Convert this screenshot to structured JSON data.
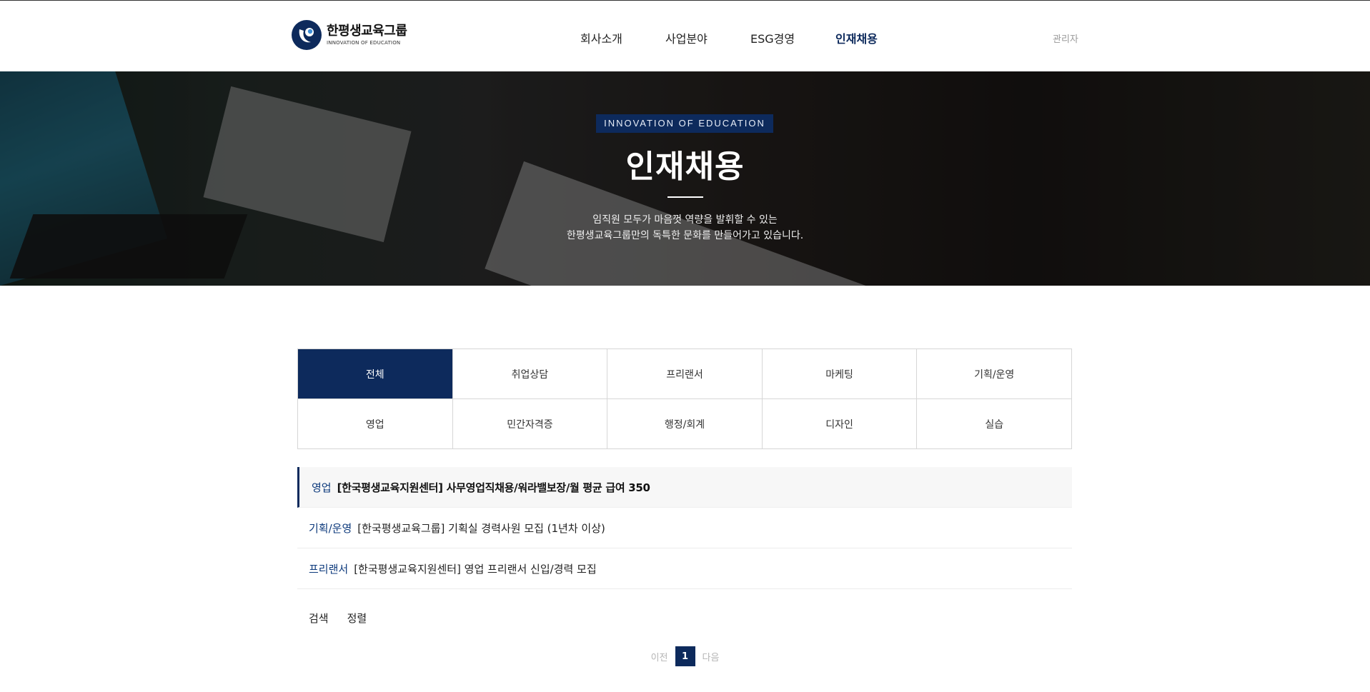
{
  "header": {
    "logo": {
      "title": "한평생교육그룹",
      "subtitle": "INNOVATION OF EDUCATION",
      "brand_color": "#0d2a5c"
    },
    "nav": [
      {
        "label": "회사소개",
        "active": false
      },
      {
        "label": "사업분야",
        "active": false
      },
      {
        "label": "ESG경영",
        "active": false
      },
      {
        "label": "인재채용",
        "active": true
      }
    ],
    "admin_label": "관리자"
  },
  "hero": {
    "tag": "INNOVATION OF EDUCATION",
    "title": "인재채용",
    "desc_line1": "임직원 모두가 마음껏 역량을 발휘할 수 있는",
    "desc_line2": "한평생교육그룹만의 독특한 문화를 만들어가고 있습니다."
  },
  "categories": {
    "active": "전체",
    "items": [
      "전체",
      "취업상담",
      "프리랜서",
      "마케팅",
      "기획/운영",
      "영업",
      "민간자격증",
      "행정/회계",
      "디자인",
      "실습"
    ]
  },
  "jobs": [
    {
      "category": "영업",
      "title": "[한국평생교육지원센터] 사무영업직채용/워라밸보장/월 평균 급여 350",
      "featured": true
    },
    {
      "category": "기획/운영",
      "title": "[한국평생교육그룹] 기획실 경력사원 모집 (1년차 이상)",
      "featured": false
    },
    {
      "category": "프리랜서",
      "title": "[한국평생교육지원센터] 영업 프리랜서 신입/경력 모집",
      "featured": false
    }
  ],
  "controls": {
    "search_label": "검색",
    "sort_label": "정렬"
  },
  "pagination": {
    "prev_label": "이전",
    "current_page": "1",
    "next_label": "다음"
  },
  "colors": {
    "accent": "#0d2a5c",
    "category_text": "#0d3a7c",
    "muted": "#b5b5b5"
  },
  "icons": [
    "logo-mark-icon"
  ]
}
